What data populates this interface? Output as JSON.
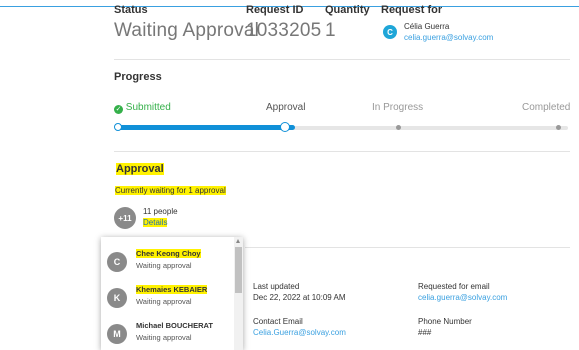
{
  "colors": {
    "accent": "#1090d8",
    "link": "#3aa0e0",
    "success": "#35b04a",
    "highlight": "#fff200",
    "avatar": "#8a8a8a"
  },
  "header": {
    "status_label": "Status",
    "status_value": "Waiting Approval",
    "request_id_label": "Request ID",
    "request_id_value": "1033205",
    "quantity_label": "Quantity",
    "quantity_value": "1",
    "request_for_label": "Request for",
    "request_for_initial": "C",
    "request_for_name": "Célia Guerra",
    "request_for_email": "celia.guerra@solvay.com"
  },
  "progress": {
    "title": "Progress",
    "steps": [
      {
        "label": "Submitted",
        "state": "done",
        "icon": "check-circle-icon"
      },
      {
        "label": "Approval",
        "state": "current"
      },
      {
        "label": "In Progress",
        "state": "pending"
      },
      {
        "label": "Completed",
        "state": "pending"
      }
    ],
    "completed_fraction": 0.33
  },
  "approval": {
    "title": "Approval",
    "waiting_text": "Currently waiting for 1 approval",
    "badge": "+11",
    "people_count": "11 people",
    "details_link": "Details"
  },
  "approvers": [
    {
      "initial": "C",
      "name": "Chee Keong Choy",
      "status": "Waiting approval",
      "highlight": true
    },
    {
      "initial": "K",
      "name": "Khemaies KEBAIER",
      "status": "Waiting approval",
      "highlight": true
    },
    {
      "initial": "M",
      "name": "Michael BOUCHERAT",
      "status": "Waiting approval",
      "highlight": false
    }
  ],
  "info": {
    "last_updated_label": "Last updated",
    "last_updated_value": "Dec 22, 2022 at 10:09 AM",
    "requested_for_email_label": "Requested for email",
    "requested_for_email_value": "celia.guerra@solvay.com",
    "contact_email_label": "Contact Email",
    "contact_email_value": "Celia.Guerra@solvay.com",
    "phone_label": "Phone Number",
    "phone_value": "###"
  }
}
